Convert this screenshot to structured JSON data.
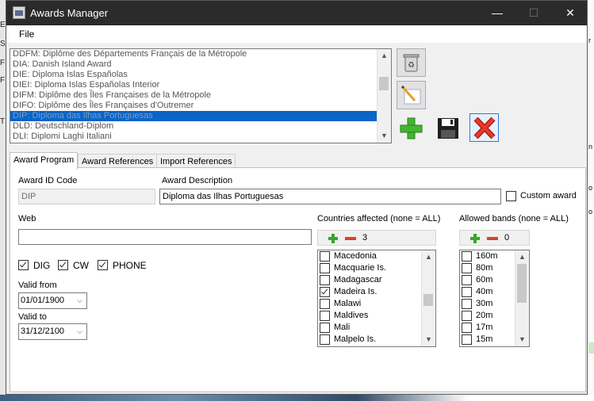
{
  "window": {
    "title": "Awards Manager",
    "minimize": "—",
    "maximize": "☐",
    "close": "✕"
  },
  "menu": {
    "file": "File"
  },
  "awards_list": {
    "items": [
      "DDFM: Diplôme des Départements Français de la Métropole",
      "DIA: Danish Island Award",
      "DIE: Diploma Islas Españolas",
      "DIEI: Diploma Islas Españolas Interior",
      "DIFM: Diplôme des Îles Françaises de la Métropole",
      "DIFO: Diplôme des Îles Françaises d'Outremer",
      "DIP: Diploma das Ilhas Portuguesas",
      "DLD: Deutschland-Diplom",
      "DLI: Diplomi Laghi Italiani"
    ],
    "selected_index": 6
  },
  "toolbar": {
    "recycle": "recycle-bin-icon",
    "edit": "edit-icon",
    "add": "add-icon",
    "save": "save-icon",
    "delete": "delete-icon"
  },
  "tabs": [
    "Award Program",
    "Award References",
    "Import References"
  ],
  "form": {
    "id_label": "Award ID Code",
    "id_value": "DIP",
    "desc_label": "Award Description",
    "desc_value": "Diploma das Ilhas Portuguesas",
    "custom_label": "Custom award",
    "web_label": "Web",
    "web_value": "",
    "modes": [
      {
        "label": "DIG",
        "checked": true
      },
      {
        "label": "CW",
        "checked": true
      },
      {
        "label": "PHONE",
        "checked": true
      }
    ],
    "valid_from_label": "Valid from",
    "valid_from": "01/01/1900",
    "valid_to_label": "Valid to",
    "valid_to": "31/12/2100"
  },
  "countries": {
    "label": "Countries affected (none = ALL)",
    "count": "3",
    "items": [
      {
        "name": "Macedonia",
        "checked": false
      },
      {
        "name": "Macquarie Is.",
        "checked": false
      },
      {
        "name": "Madagascar",
        "checked": false
      },
      {
        "name": "Madeira Is.",
        "checked": true
      },
      {
        "name": "Malawi",
        "checked": false
      },
      {
        "name": "Maldives",
        "checked": false
      },
      {
        "name": "Mali",
        "checked": false
      },
      {
        "name": "Malpelo Is.",
        "checked": false
      }
    ]
  },
  "bands": {
    "label": "Allowed bands (none = ALL)",
    "count": "0",
    "items": [
      {
        "name": "160m",
        "checked": false
      },
      {
        "name": "80m",
        "checked": false
      },
      {
        "name": "60m",
        "checked": false
      },
      {
        "name": "40m",
        "checked": false
      },
      {
        "name": "30m",
        "checked": false
      },
      {
        "name": "20m",
        "checked": false
      },
      {
        "name": "17m",
        "checked": false
      },
      {
        "name": "15m",
        "checked": false
      }
    ]
  },
  "background": {
    "left_letters": [
      "S",
      "E",
      "F",
      "F",
      "T"
    ],
    "right_letters": [
      "r",
      "n",
      "o",
      "o",
      "C",
      "C",
      "D",
      "D",
      "2"
    ]
  }
}
